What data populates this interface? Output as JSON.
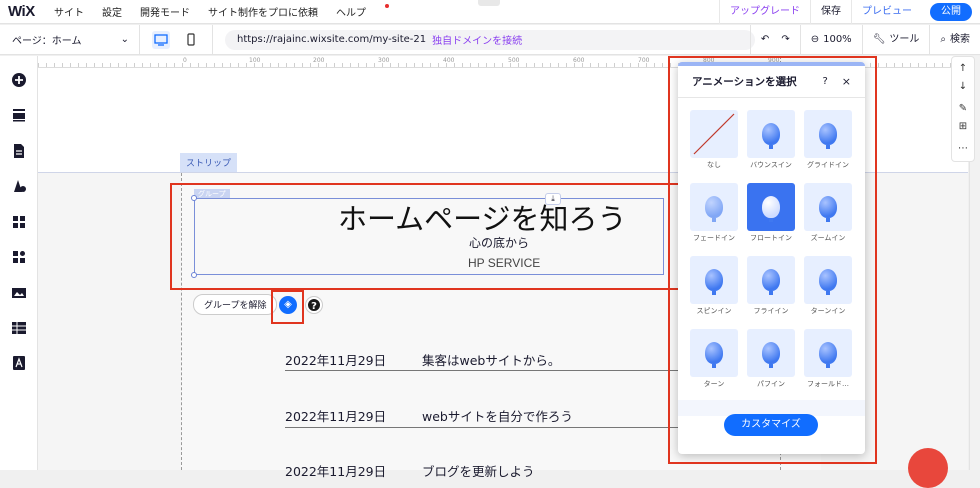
{
  "topbar": {
    "logo": "WiX",
    "menu": [
      "サイト",
      "設定",
      "開発モード",
      "サイト制作をプロに依頼",
      "ヘルプ"
    ],
    "upgrade": "アップグレード",
    "save": "保存",
    "preview": "プレビュー",
    "publish": "公開"
  },
  "toolbar": {
    "page_select": "ページ：ホーム",
    "url": "https://rajainc.wixsite.com/my-site-21",
    "connect_domain": "独自ドメインを接続",
    "zoom": "100%",
    "tools": "ツール",
    "search": "検索"
  },
  "ruler": [
    "0",
    "100",
    "200",
    "300",
    "400",
    "500",
    "600",
    "700",
    "800",
    "900"
  ],
  "canvas": {
    "strip_label": "ストリップ",
    "group_label": "グループ",
    "title": "ホームページを知ろう",
    "subtitle": "心の底から",
    "service": "HP SERVICE",
    "ungroup_button": "グループを解除",
    "help_symbol": "?",
    "rows": [
      {
        "date": "2022年11月29日",
        "text": "集客はwebサイトから。"
      },
      {
        "date": "2022年11月29日",
        "text": "webサイトを自分で作ろう"
      },
      {
        "date": "2022年11月29日",
        "text": "ブログを更新しよう"
      }
    ]
  },
  "animation_panel": {
    "title": "アニメーションを選択",
    "help": "?",
    "close": "×",
    "items": [
      {
        "label": "なし",
        "icon": "none-slash-icon"
      },
      {
        "label": "バウンスイン",
        "icon": "balloon-icon"
      },
      {
        "label": "グライドイン",
        "icon": "balloon-icon"
      },
      {
        "label": "フェードイン",
        "icon": "balloon-icon"
      },
      {
        "label": "フロートイン",
        "icon": "balloon-icon",
        "selected": true
      },
      {
        "label": "ズームイン",
        "icon": "balloon-icon"
      },
      {
        "label": "スピンイン",
        "icon": "balloon-icon"
      },
      {
        "label": "フライイン",
        "icon": "balloon-icon"
      },
      {
        "label": "ターンイン",
        "icon": "balloon-icon"
      },
      {
        "label": "ターン",
        "icon": "balloon-icon"
      },
      {
        "label": "パフイン",
        "icon": "balloon-icon"
      },
      {
        "label": "フォールド…",
        "icon": "balloon-icon"
      }
    ],
    "customize_button": "カスタマイズ"
  },
  "colors": {
    "accent": "#116dff",
    "highlight": "#e0351f",
    "upgrade": "#8a3ff0"
  }
}
